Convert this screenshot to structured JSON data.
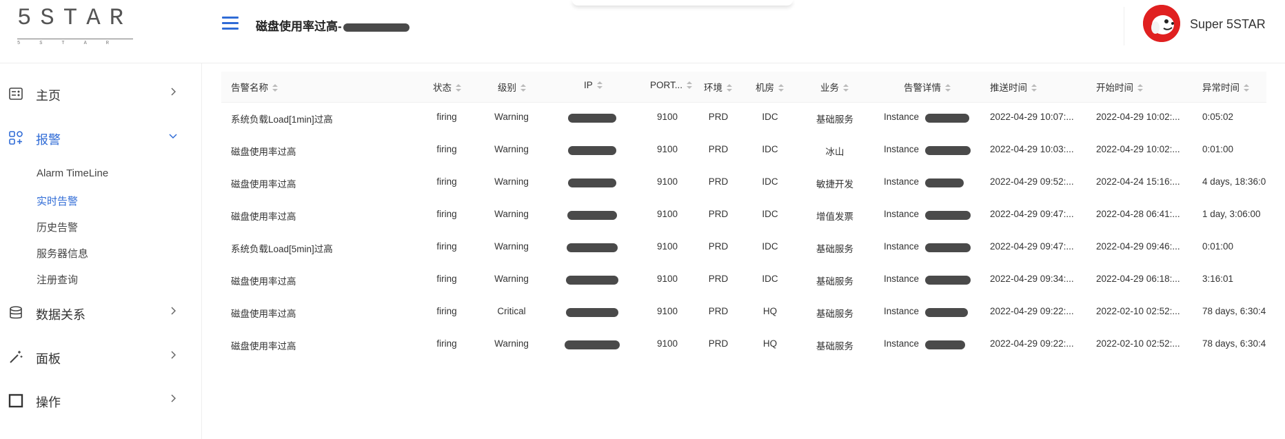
{
  "brand": {
    "logo_big": "5STAR",
    "logo_small": "5STAR"
  },
  "header": {
    "title": "磁盘使用率过高-",
    "user_name": "Super 5STAR"
  },
  "sidebar": {
    "items": [
      {
        "label": "主页",
        "icon": "dashboard-icon"
      },
      {
        "label": "报警",
        "icon": "apps-icon",
        "expanded": true
      },
      {
        "label": "数据关系",
        "icon": "database-icon"
      },
      {
        "label": "面板",
        "icon": "magic-wand-icon"
      },
      {
        "label": "操作",
        "icon": "square-icon"
      }
    ],
    "sub_items": [
      "Alarm TimeLine",
      "实时告警",
      "历史告警",
      "服务器信息",
      "注册查询"
    ],
    "active_sub": "实时告警"
  },
  "table": {
    "columns": [
      "告警名称",
      "状态",
      "级别",
      "IP",
      "PORT...",
      "环境",
      "机房",
      "业务",
      "告警详情",
      "推送时间",
      "开始时间",
      "异常时间"
    ],
    "rows": [
      {
        "name": "系统负载Load[1min]过高",
        "status": "firing",
        "level": "Warning",
        "port": "9100",
        "env": "PRD",
        "room": "IDC",
        "biz": "基础服务",
        "detail": "Instance",
        "push": "2022-04-29 10:07:...",
        "start": "2022-04-29 10:02:...",
        "duration": "0:05:02"
      },
      {
        "name": "磁盘使用率过高",
        "status": "firing",
        "level": "Warning",
        "port": "9100",
        "env": "PRD",
        "room": "IDC",
        "biz": "冰山",
        "detail": "Instance",
        "push": "2022-04-29 10:03:...",
        "start": "2022-04-29 10:02:...",
        "duration": "0:01:00"
      },
      {
        "name": "磁盘使用率过高",
        "status": "firing",
        "level": "Warning",
        "port": "9100",
        "env": "PRD",
        "room": "IDC",
        "biz": "敏捷开发",
        "detail": "Instance",
        "push": "2022-04-29 09:52:...",
        "start": "2022-04-24 15:16:...",
        "duration": "4 days, 18:36:0"
      },
      {
        "name": "磁盘使用率过高",
        "status": "firing",
        "level": "Warning",
        "port": "9100",
        "env": "PRD",
        "room": "IDC",
        "biz": "增值发票",
        "detail": "Instance",
        "push": "2022-04-29 09:47:...",
        "start": "2022-04-28 06:41:...",
        "duration": "1 day, 3:06:00"
      },
      {
        "name": "系统负载Load[5min]过高",
        "status": "firing",
        "level": "Warning",
        "port": "9100",
        "env": "PRD",
        "room": "IDC",
        "biz": "基础服务",
        "detail": "Instance",
        "push": "2022-04-29 09:47:...",
        "start": "2022-04-29 09:46:...",
        "duration": "0:01:00"
      },
      {
        "name": "磁盘使用率过高",
        "status": "firing",
        "level": "Warning",
        "port": "9100",
        "env": "PRD",
        "room": "IDC",
        "biz": "基础服务",
        "detail": "Instance",
        "push": "2022-04-29 09:34:...",
        "start": "2022-04-29 06:18:...",
        "duration": "3:16:01"
      },
      {
        "name": "磁盘使用率过高",
        "status": "firing",
        "level": "Critical",
        "port": "9100",
        "env": "PRD",
        "room": "HQ",
        "biz": "基础服务",
        "detail": "Instance",
        "push": "2022-04-29 09:22:...",
        "start": "2022-02-10 02:52:...",
        "duration": "78 days, 6:30:4"
      },
      {
        "name": "磁盘使用率过高",
        "status": "firing",
        "level": "Warning",
        "port": "9100",
        "env": "PRD",
        "room": "HQ",
        "biz": "基础服务",
        "detail": "Instance",
        "push": "2022-04-29 09:22:...",
        "start": "2022-02-10 02:52:...",
        "duration": "78 days, 6:30:4"
      }
    ]
  },
  "colors": {
    "accent": "#2f6bd6",
    "avatar_bg": "#e02020",
    "redaction": "#4a4a4a"
  }
}
